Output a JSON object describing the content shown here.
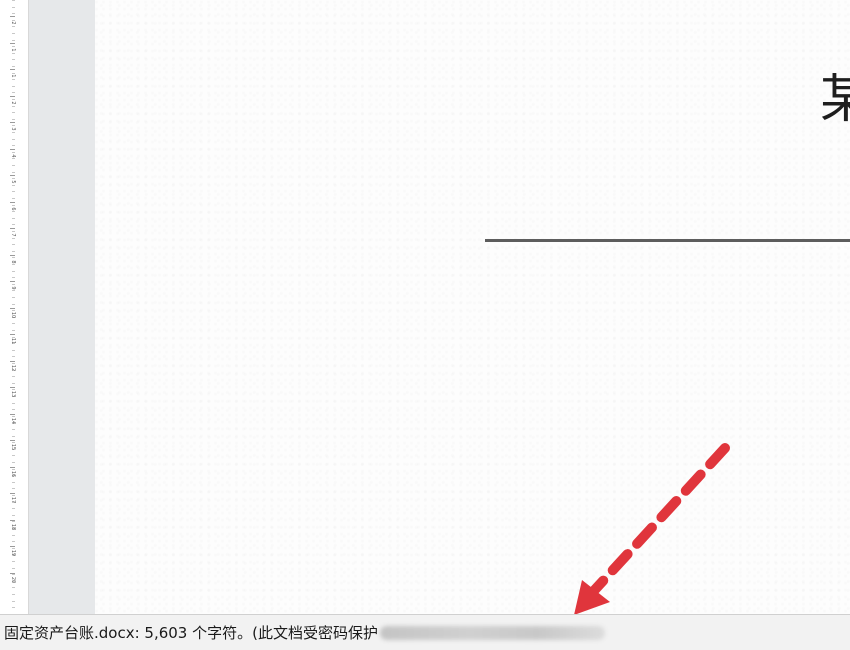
{
  "document": {
    "title_fragment": "某"
  },
  "ruler": {
    "labels": [
      "2",
      "1",
      "1",
      "2",
      "3",
      "4",
      "5",
      "6",
      "7",
      "8",
      "9",
      "10",
      "11",
      "12",
      "13",
      "14",
      "15",
      "16",
      "17",
      "18",
      "19",
      "20"
    ]
  },
  "status_bar": {
    "text": "固定资产台账.docx: 5,603 个字符。(此文档受密码保护"
  },
  "colors": {
    "annotation_arrow": "#e0353c",
    "margin_strip": "#e6e8ea",
    "status_bar": "#f2f2f2"
  },
  "icons": {
    "annotation": "dashed-arrow-icon"
  }
}
